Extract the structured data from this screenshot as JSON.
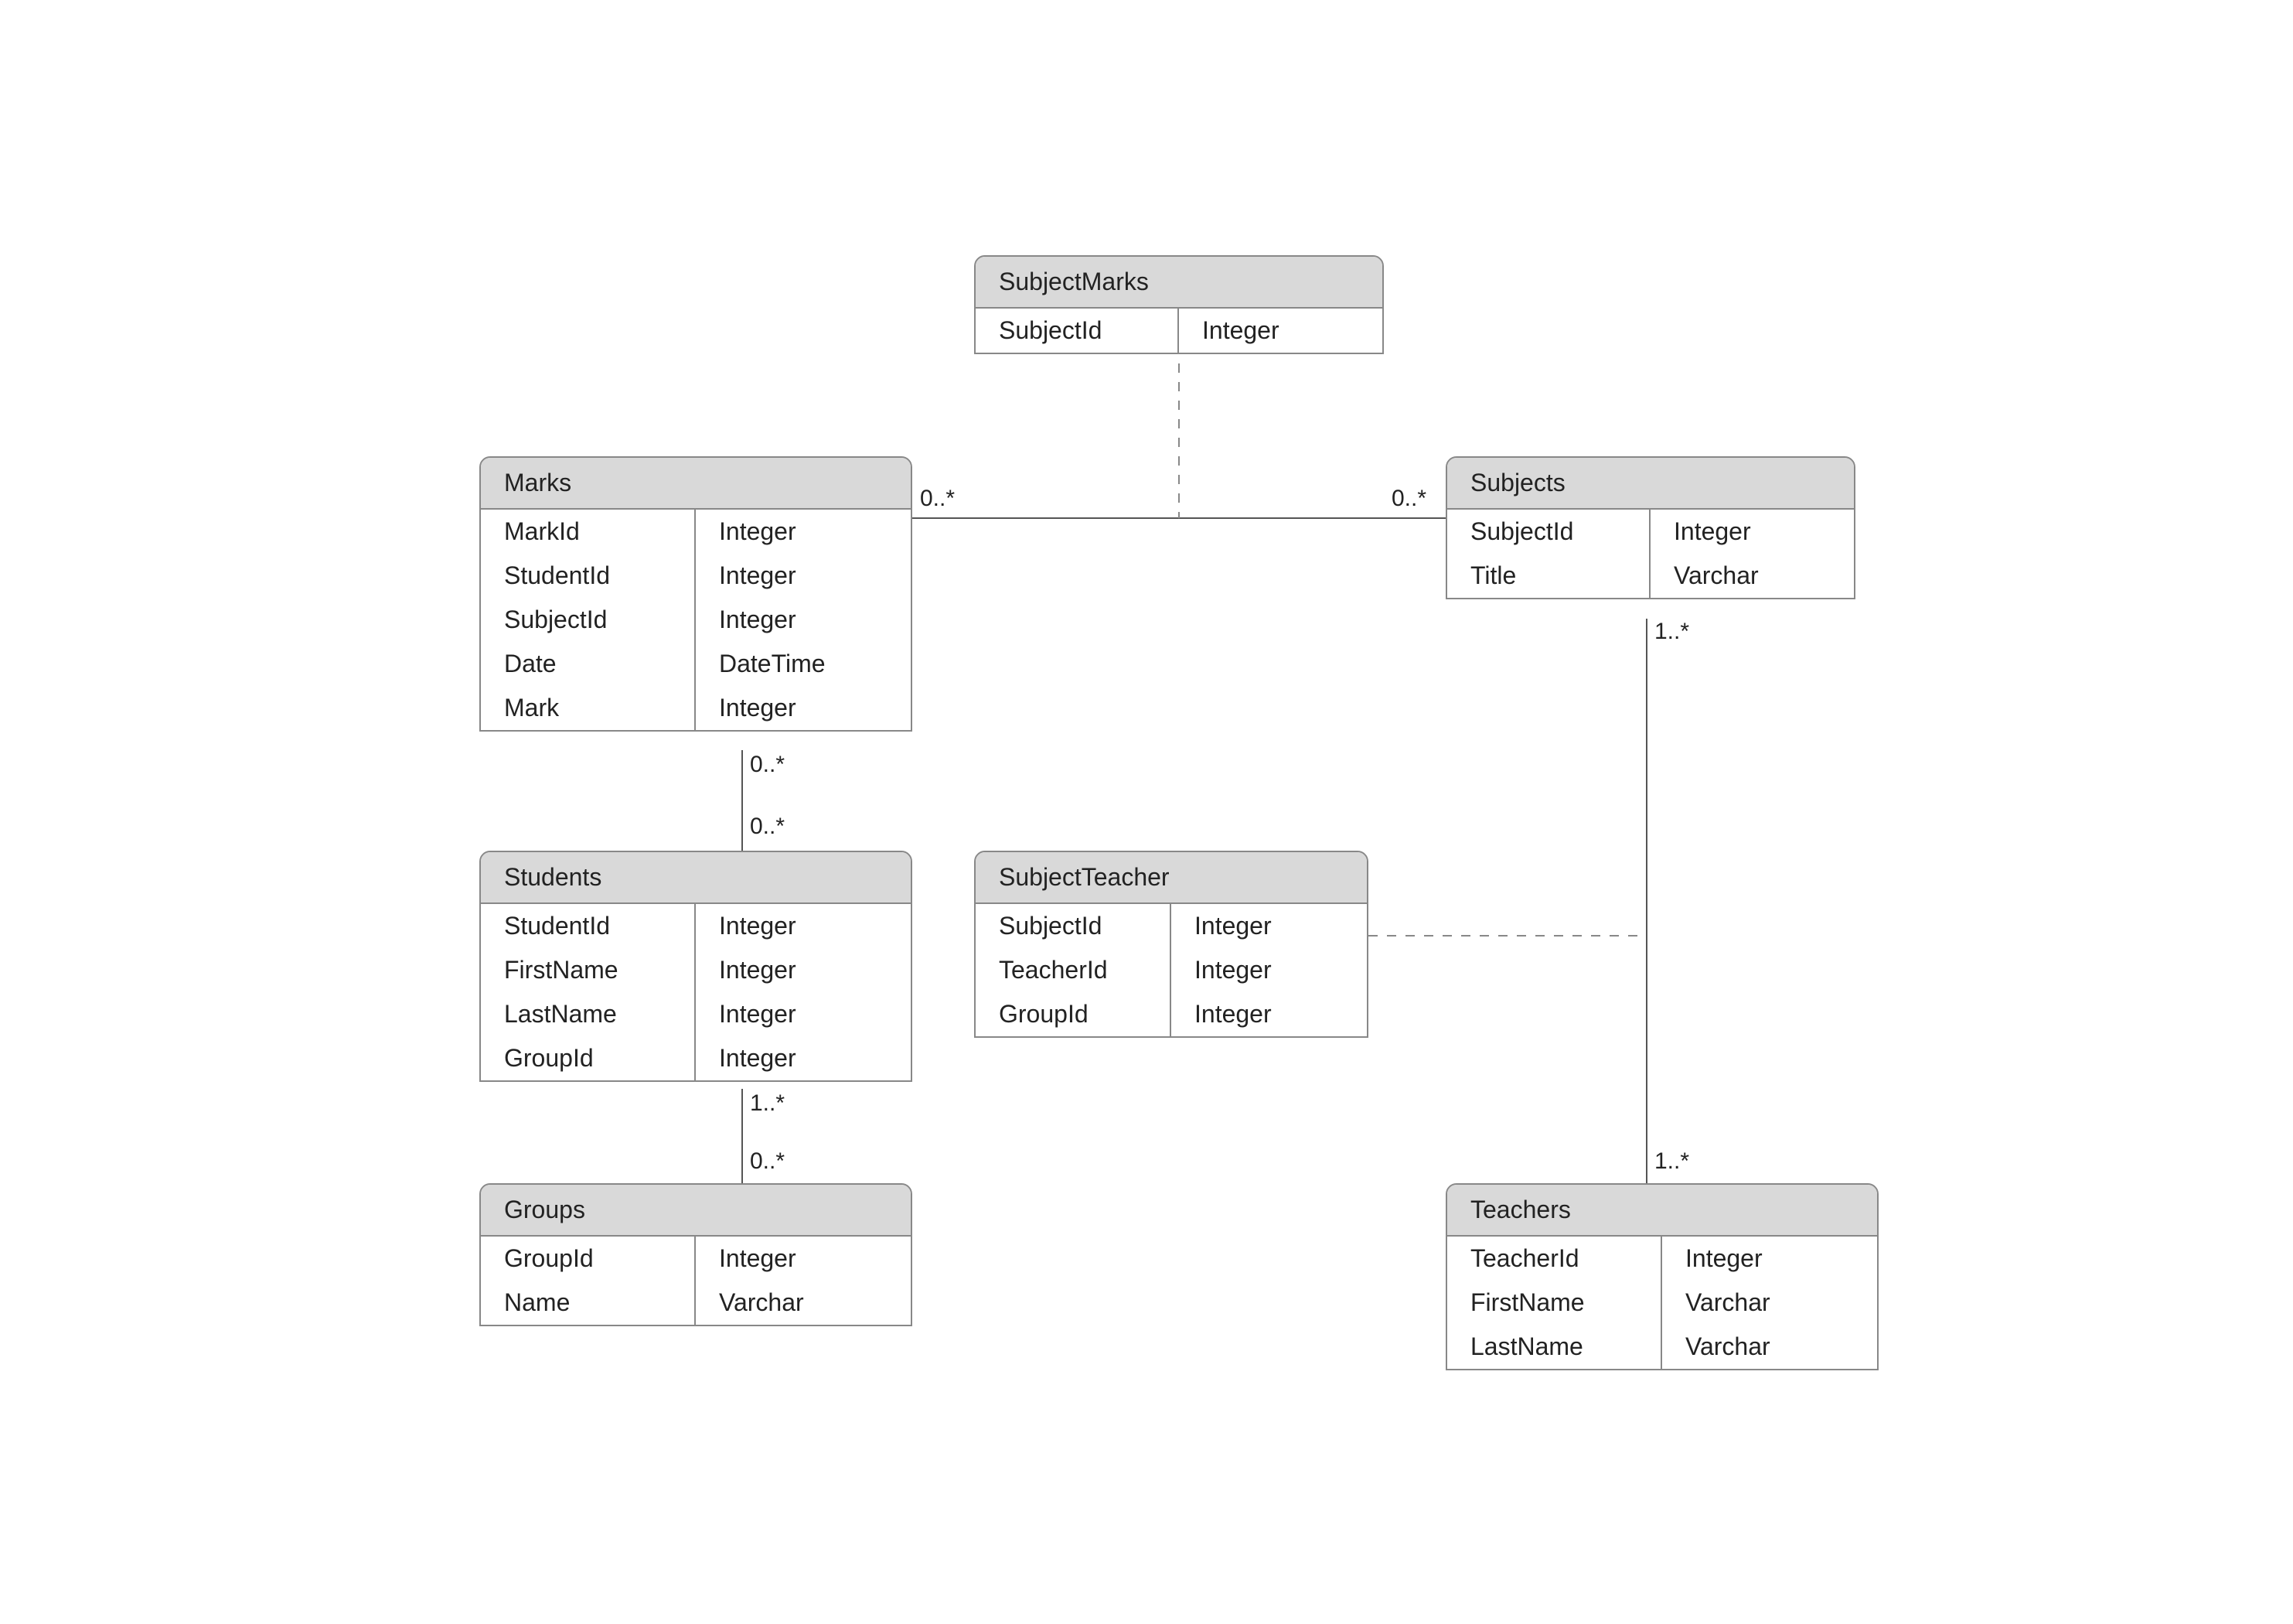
{
  "entities": {
    "subjectMarks": {
      "title": "SubjectMarks",
      "fields": [
        {
          "name": "SubjectId",
          "type": "Integer"
        }
      ]
    },
    "marks": {
      "title": "Marks",
      "fields": [
        {
          "name": "MarkId",
          "type": "Integer"
        },
        {
          "name": "StudentId",
          "type": "Integer"
        },
        {
          "name": "SubjectId",
          "type": "Integer"
        },
        {
          "name": "Date",
          "type": "DateTime"
        },
        {
          "name": "Mark",
          "type": "Integer"
        }
      ]
    },
    "subjects": {
      "title": "Subjects",
      "fields": [
        {
          "name": "SubjectId",
          "type": "Integer"
        },
        {
          "name": "Title",
          "type": "Varchar"
        }
      ]
    },
    "students": {
      "title": "Students",
      "fields": [
        {
          "name": "StudentId",
          "type": "Integer"
        },
        {
          "name": "FirstName",
          "type": "Integer"
        },
        {
          "name": "LastName",
          "type": "Integer"
        },
        {
          "name": "GroupId",
          "type": "Integer"
        }
      ]
    },
    "subjectTeacher": {
      "title": "SubjectTeacher",
      "fields": [
        {
          "name": "SubjectId",
          "type": "Integer"
        },
        {
          "name": "TeacherId",
          "type": "Integer"
        },
        {
          "name": "GroupId",
          "type": "Integer"
        }
      ]
    },
    "groups": {
      "title": "Groups",
      "fields": [
        {
          "name": "GroupId",
          "type": "Integer"
        },
        {
          "name": "Name",
          "type": "Varchar"
        }
      ]
    },
    "teachers": {
      "title": "Teachers",
      "fields": [
        {
          "name": "TeacherId",
          "type": "Integer"
        },
        {
          "name": "FirstName",
          "type": "Varchar"
        },
        {
          "name": "LastName",
          "type": "Varchar"
        }
      ]
    }
  },
  "multiplicities": {
    "marks_to_subjectmarks_left": "0..*",
    "marks_to_subjectmarks_right": "0..*",
    "marks_bottom": "0..*",
    "students_top": "0..*",
    "students_bottom": "1..*",
    "groups_top": "0..*",
    "subjects_bottom": "1..*",
    "teachers_top": "1..*"
  }
}
